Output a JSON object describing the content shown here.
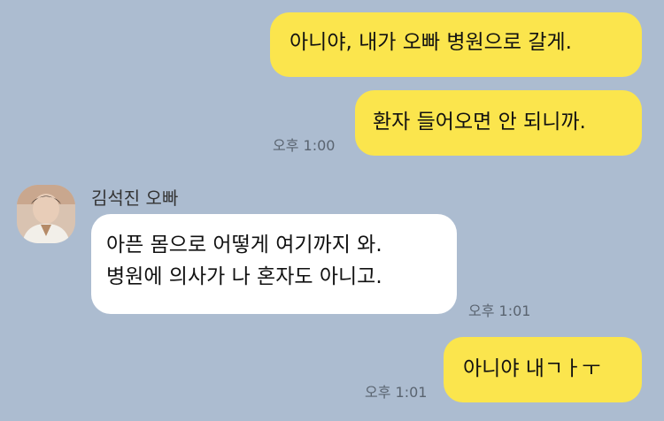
{
  "messages": [
    {
      "text": "아니야, 내가 오빠 병원으로 갈게."
    },
    {
      "text": "환자 들어오면 안 되니까.",
      "time": "오후 1:00"
    },
    {
      "sender": "김석진 오빠",
      "lines": [
        "아픈 몸으로 어떻게 여기까지 와.",
        "병원에 의사가 나 혼자도 아니고."
      ],
      "time": "오후 1:01"
    },
    {
      "text": "아니야 내ㄱㅏㅜ",
      "time": "오후 1:01"
    }
  ],
  "colors": {
    "background": "#acbcd0",
    "mine_bubble": "#fbe54d",
    "their_bubble": "#ffffff"
  }
}
